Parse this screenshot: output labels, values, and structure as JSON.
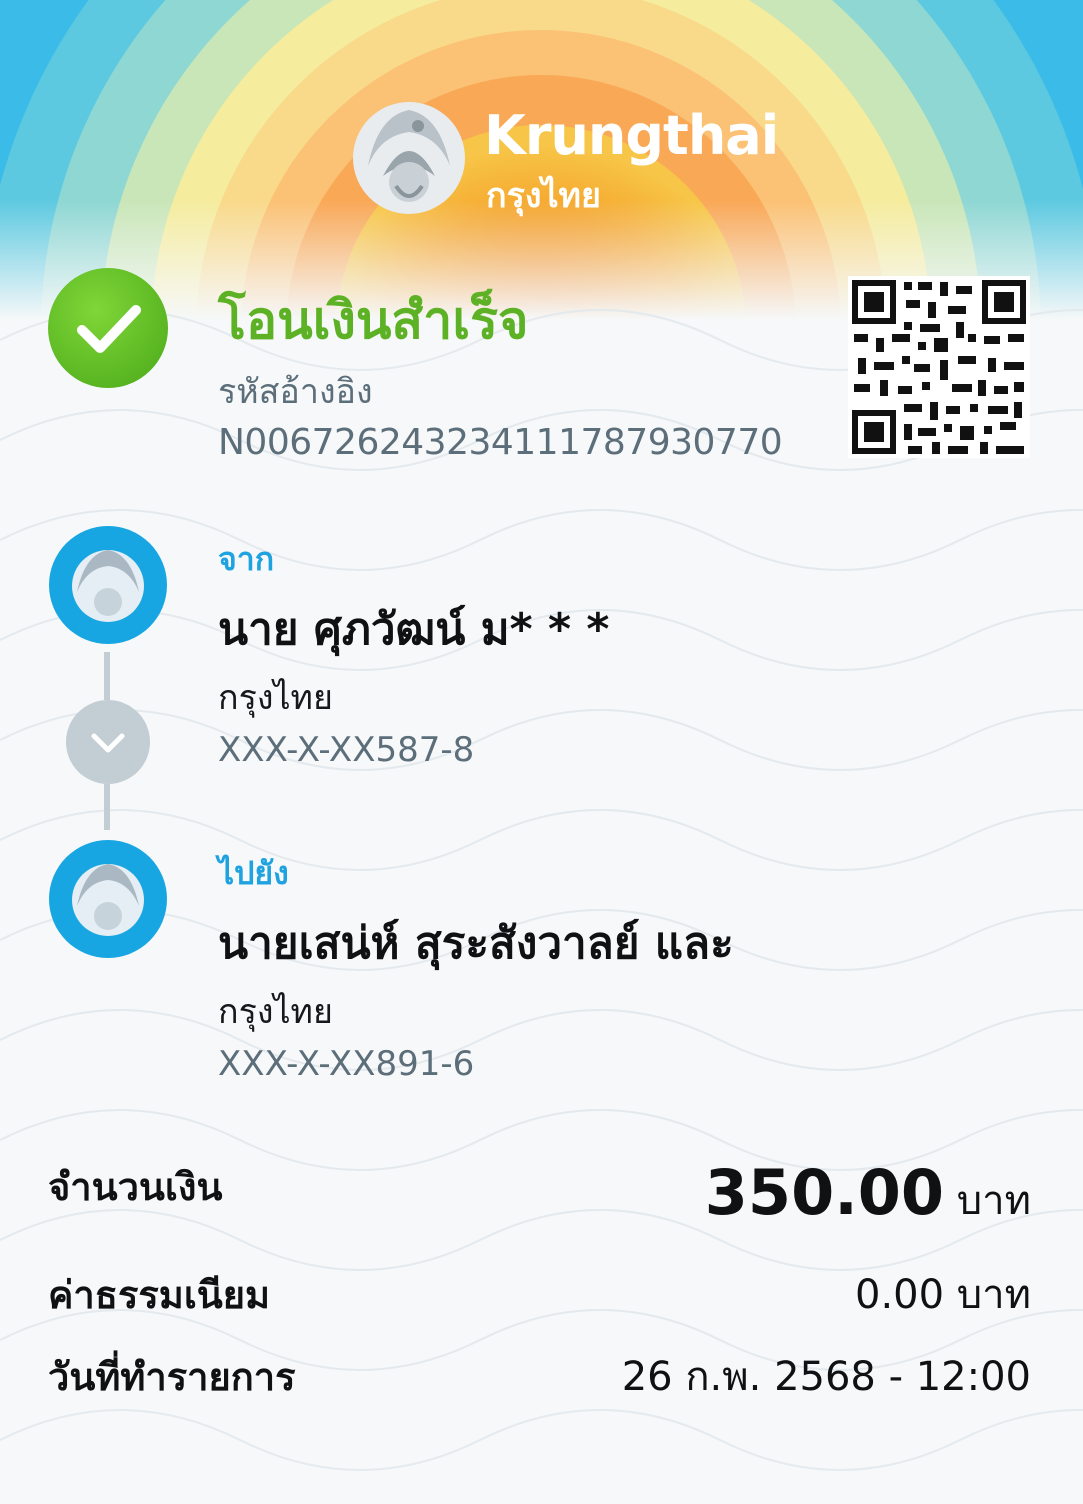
{
  "brand": {
    "name_en": "Krungthai",
    "name_th": "กรุงไทย"
  },
  "status": {
    "title": "โอนเงินสำเร็จ",
    "ref_label": "รหัสอ้างอิง",
    "ref_value": "N006726243234111787930770"
  },
  "from": {
    "label": "จาก",
    "name": "นาย ศุภวัฒน์ ม* * *",
    "bank": "กรุงไทย",
    "account": "XXX-X-XX587-8"
  },
  "to": {
    "label": "ไปยัง",
    "name": "นายเสน่ห์ สุระสังวาลย์ และ",
    "bank": "กรุงไทย",
    "account": "XXX-X-XX891-6"
  },
  "amount": {
    "label": "จำนวนเงิน",
    "value": "350.00",
    "unit": "บาท"
  },
  "fee": {
    "label": "ค่าธรรมเนียม",
    "value": "0.00 บาท"
  },
  "date": {
    "label": "วันที่ทำรายการ",
    "value": "26 ก.พ. 2568 - 12:00"
  },
  "colors": {
    "success_green": "#5db125",
    "accent_blue": "#1ea2e0",
    "secondary_text": "#5c6e7a"
  },
  "icons": [
    "success-check-icon",
    "krungthai-bird-logo",
    "qr-code",
    "chevron-down-icon"
  ]
}
